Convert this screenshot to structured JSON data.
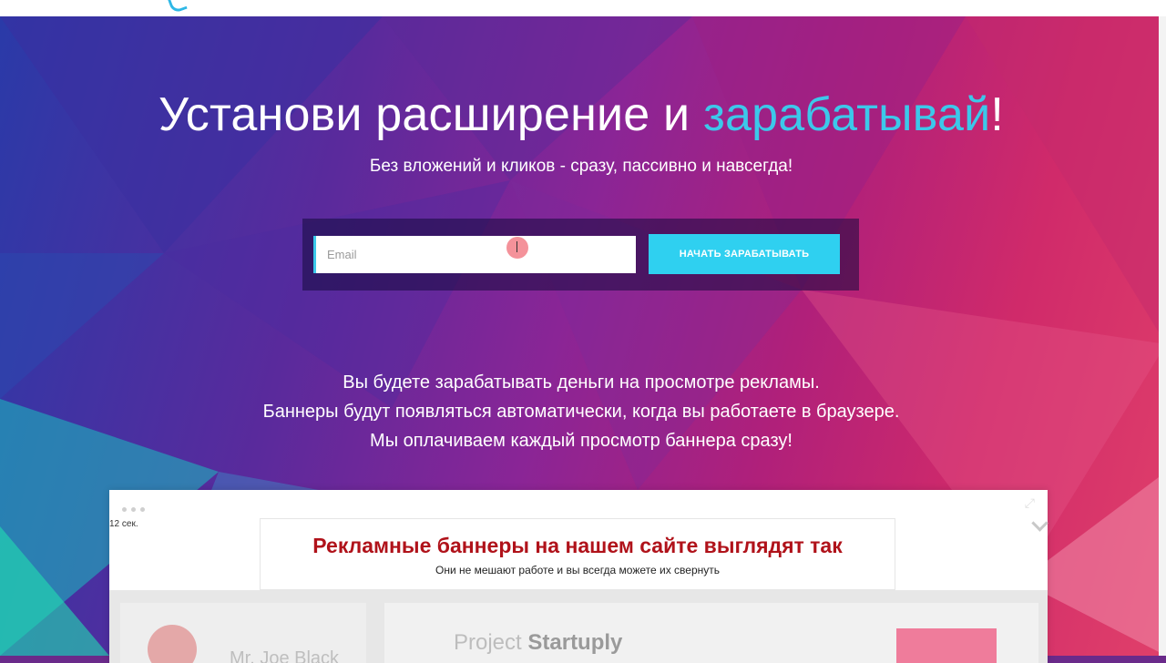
{
  "hero": {
    "headline_main": "Установи расширение и ",
    "headline_accent": "зарабатывай",
    "headline_end": "!",
    "subheadline": "Без вложений и кликов - сразу, пассивно и навсегда!"
  },
  "signup": {
    "email_placeholder": "Email",
    "button_label": "НАЧАТЬ ЗАРАБАТЫВАТЬ"
  },
  "info_lines": [
    "Вы будете зарабатывать деньги на просмотре рекламы.",
    "Баннеры будут появляться автоматически, когда вы работаете в браузере.",
    "Мы оплачиваем каждый просмотр баннера сразу!"
  ],
  "demo": {
    "timer": "12 сек.",
    "ad_title": "Рекламные баннеры на нашем сайте выглядят так",
    "ad_subtitle": "Они не мешают работе и вы всегда можете их свернуть",
    "person_name": "Mr. Joe Black",
    "project_light": "Project ",
    "project_bold": "Startuply"
  },
  "colors": {
    "accent": "#3cc8ea",
    "button": "#2fd0f0",
    "ad_title": "#b0121a"
  }
}
